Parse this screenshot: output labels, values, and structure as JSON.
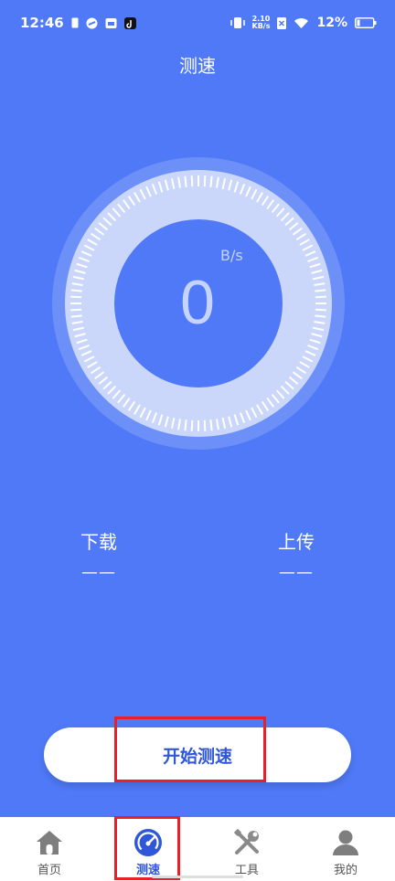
{
  "status_bar": {
    "time": "12:46",
    "net_speed_value": "2.10",
    "net_speed_unit": "KB/s",
    "battery_percent": "12%"
  },
  "title": "测速",
  "gauge": {
    "unit": "B/s",
    "value": "0"
  },
  "stats": {
    "download_label": "下载",
    "download_value": "——",
    "upload_label": "上传",
    "upload_value": "——"
  },
  "start_button_label": "开始测速",
  "nav": {
    "items": [
      {
        "label": "首页",
        "icon": "home-icon"
      },
      {
        "label": "测速",
        "icon": "speedometer-icon",
        "active": true
      },
      {
        "label": "工具",
        "icon": "tools-icon"
      },
      {
        "label": "我的",
        "icon": "profile-icon"
      }
    ]
  },
  "colors": {
    "background": "#4F79F7",
    "accent": "#2E57D9",
    "highlight": "#E8202A"
  }
}
